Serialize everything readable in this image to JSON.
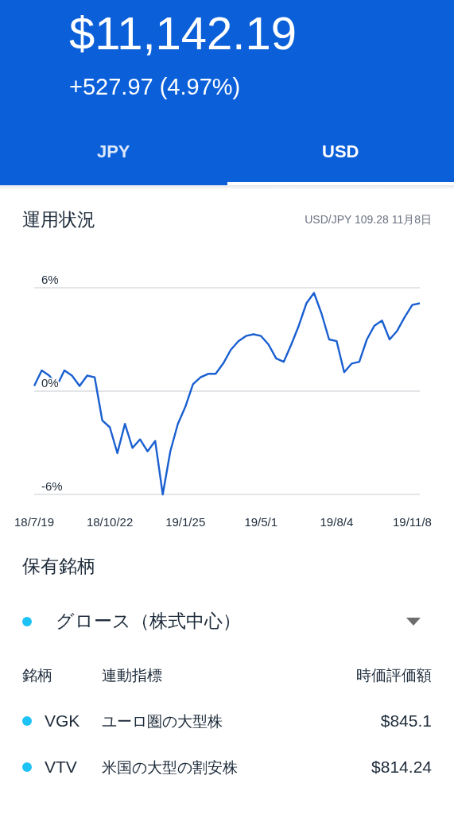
{
  "header": {
    "balance": "$11,142.19",
    "change": "+527.97 (4.97%)"
  },
  "tabs": [
    {
      "label": "JPY",
      "selected": false
    },
    {
      "label": "USD",
      "selected": true
    }
  ],
  "performance": {
    "title": "運用状況",
    "rate": "USD/JPY 109.28 11月8日",
    "chart_data": {
      "type": "line",
      "categories": [
        "18/7/19",
        null,
        null,
        null,
        null,
        null,
        null,
        null,
        null,
        null,
        "18/10/22",
        null,
        null,
        null,
        null,
        null,
        null,
        null,
        null,
        null,
        "19/1/25",
        null,
        null,
        null,
        null,
        null,
        null,
        null,
        null,
        null,
        "19/5/1",
        null,
        null,
        null,
        null,
        null,
        null,
        null,
        null,
        null,
        "19/8/4",
        null,
        null,
        null,
        null,
        null,
        null,
        null,
        null,
        null,
        "19/11/8",
        null
      ],
      "series": [
        {
          "color": "#1a5fd0",
          "values": [
            0.3,
            1.2,
            0.9,
            0.3,
            1.2,
            0.9,
            0.3,
            0.9,
            0.8,
            -1.7,
            -2.1,
            -3.6,
            -1.9,
            -3.3,
            -2.8,
            -3.5,
            -2.9,
            -6.0,
            -3.5,
            -1.9,
            -0.9,
            0.4,
            0.8,
            1.0,
            1.0,
            1.6,
            2.4,
            2.9,
            3.2,
            3.3,
            3.2,
            2.7,
            1.9,
            1.7,
            2.7,
            3.8,
            5.1,
            5.7,
            4.5,
            3.0,
            2.9,
            1.1,
            1.6,
            1.7,
            3.0,
            3.8,
            4.1,
            3.0,
            3.5,
            4.3,
            5.0,
            5.1
          ]
        }
      ],
      "ylim": [
        -6,
        6
      ],
      "yticks": [
        {
          "value": 6,
          "label": "6%"
        },
        {
          "value": 0,
          "label": "0%"
        },
        {
          "value": -6,
          "label": "-6%"
        }
      ]
    }
  },
  "holdings": {
    "title": "保有銘柄",
    "portfolio": {
      "label": "グロース（株式中心）",
      "color": "#1ec3f5"
    },
    "columns": [
      "銘柄",
      "連動指標",
      "時価評価額"
    ],
    "rows": [
      {
        "ticker": "VGK",
        "index": "ユーロ圏の大型株",
        "value": "$845.1",
        "color": "#1ec3f5"
      },
      {
        "ticker": "VTV",
        "index": "米国の大型の割安株",
        "value": "$814.24",
        "color": "#1ec3f5"
      }
    ]
  }
}
